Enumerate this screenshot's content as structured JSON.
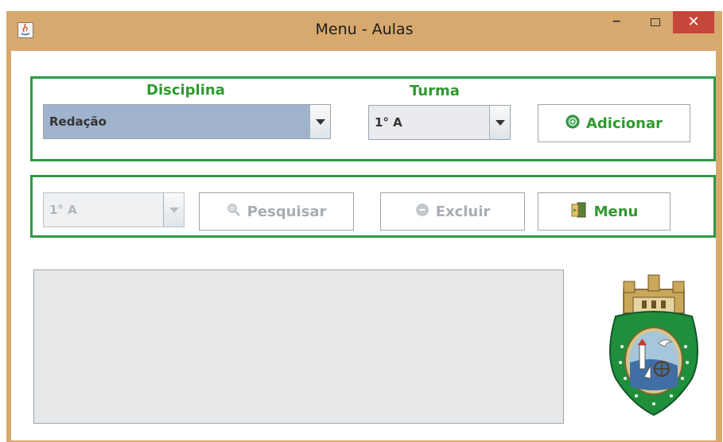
{
  "window": {
    "title": "Menu - Aulas",
    "minimize_glyph": "–",
    "close_glyph": "✕"
  },
  "top_group": {
    "disciplina_label": "Disciplina",
    "disciplina_value": "Redação",
    "turma_label": "Turma",
    "turma_value": "1° A",
    "add_button_label": "Adicionar",
    "add_icon": "plus-circle-icon"
  },
  "bottom_group": {
    "filter_value": "1° A",
    "search_button_label": "Pesquisar",
    "search_icon": "magnifier-icon",
    "delete_button_label": "Excluir",
    "delete_icon": "minus-circle-icon",
    "menu_button_label": "Menu",
    "menu_icon": "door-exit-icon"
  },
  "emblem": {
    "name": "coat-of-arms-icon"
  },
  "colors": {
    "accent_green": "#2f9a2f",
    "frame_green": "#2e9a45",
    "titlebar": "#d7a96e",
    "close_red": "#c7463a",
    "selected_combo": "#9fb3cd"
  }
}
